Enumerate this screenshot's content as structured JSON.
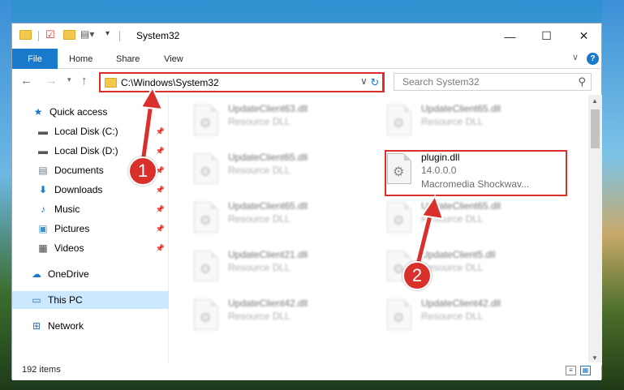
{
  "window": {
    "title": "System32",
    "ribbon_tabs": [
      "File",
      "Home",
      "Share",
      "View"
    ]
  },
  "address_bar": {
    "path": "C:\\Windows\\System32",
    "search_placeholder": "Search System32"
  },
  "sidebar": {
    "items": [
      {
        "label": "Quick access",
        "icon": "star-icon"
      },
      {
        "label": "Local Disk (C:)",
        "icon": "drive-icon"
      },
      {
        "label": "Local Disk (D:)",
        "icon": "drive-icon"
      },
      {
        "label": "Documents",
        "icon": "documents-icon"
      },
      {
        "label": "Downloads",
        "icon": "download-icon"
      },
      {
        "label": "Music",
        "icon": "music-icon"
      },
      {
        "label": "Pictures",
        "icon": "pictures-icon"
      },
      {
        "label": "Videos",
        "icon": "videos-icon"
      },
      {
        "label": "OneDrive",
        "icon": "cloud-icon"
      },
      {
        "label": "This PC",
        "icon": "computer-icon"
      },
      {
        "label": "Network",
        "icon": "network-icon"
      }
    ]
  },
  "files": {
    "col1": [
      {
        "name": "UpdateClient63.dll",
        "type": "Resource DLL"
      },
      {
        "name": "UpdateClient65.dll",
        "type": "Resource DLL"
      },
      {
        "name": "UpdateClient65.dll",
        "type": "Resource DLL"
      },
      {
        "name": "UpdateClient21.dll",
        "type": "Resource DLL"
      },
      {
        "name": "UpdateClient42.dll",
        "type": "Resource DLL"
      }
    ],
    "col2": [
      {
        "name": "UpdateClient65.dll",
        "type": "Resource DLL"
      },
      {
        "name": "UpdateClient65.dll",
        "type": "Resource DLL"
      },
      {
        "name": "UpdateClient5.dll",
        "type": "Resource DLL"
      },
      {
        "name": "UpdateClient42.dll",
        "type": "Resource DLL"
      }
    ],
    "highlighted": {
      "name": "plugin.dll",
      "version": "14.0.0.0",
      "description": "Macromedia Shockwav..."
    }
  },
  "status": {
    "item_count": "192 items"
  },
  "annotations": {
    "step1": "1",
    "step2": "2"
  },
  "colors": {
    "accent": "#1979ca",
    "annotation": "#d9302c",
    "selected": "#cce8ff"
  }
}
